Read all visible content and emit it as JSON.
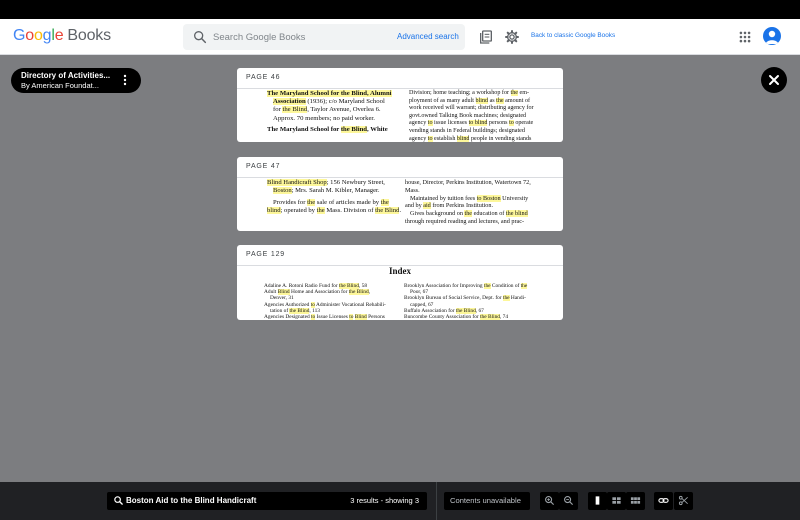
{
  "header": {
    "logo_google": "Google",
    "logo_books": "Books",
    "search_placeholder": "Search Google Books",
    "advanced_search": "Advanced search",
    "back_to_classic": "Back to classic Google Books"
  },
  "book": {
    "title": "Directory of Activities...",
    "author": "By American Foundat..."
  },
  "results": [
    {
      "page_label": "PAGE 46",
      "left": [
        "The Maryland School for the Blind, Alumni",
        "Association (1936); c/o Maryland School",
        "for the Blind, Taylor Avenue, Overlea 6.",
        "Approx. 70 members; no paid worker.",
        "The Maryland School for the Blind, White"
      ],
      "right": [
        "Division; home teaching; a workshop for the em-",
        "ployment of as many adult blind as the amount of",
        "work received will warrant; distributing agency for",
        "govt.owned Talking Book machines; designated",
        "agency to issue licenses to blind persons to operate",
        "vending stands in Federal buildings; designated",
        "agency to establish blind people in vending stands"
      ]
    },
    {
      "page_label": "PAGE 47",
      "left": [
        "Blind Handicraft Shop; 156 Newbury Street,",
        "Boston; Mrs. Sarah M. Kibler, Manager.",
        "Provides for the sale of articles made by the",
        "blind; operated by the Mass. Division of the Blind."
      ],
      "right": [
        "house, Director, Perkins Institution, Watertown 72,",
        "Mass.",
        "Maintained by tuition fees to Boston University",
        "and by aid from Perkins Institution.",
        "Gives background on the education of the blind",
        "through required reading and lectures, and prac-"
      ]
    },
    {
      "page_label": "PAGE 129",
      "index_title": "Index",
      "left": [
        "Adaline A. Rotoni Radio Fund for the Blind, 58",
        "Adult Blind Home and Association for the Blind,",
        "Denver, 31",
        "Agencies Authorized to Administer Vocational Rehabili-",
        "tation of the Blind, 113",
        "Agencies Designated to Issue Licenses to Blind Persons"
      ],
      "right": [
        "Brooklyn Association for Improving the Condition of the",
        "Poor, 67",
        "Brooklyn Bureau of Social Service, Dept. for the Handi-",
        "capped, 67",
        "Buffalo Association for the Blind, 67",
        "Buncombe County Association for the Blind, 74"
      ]
    }
  ],
  "bottom": {
    "query": "Boston Aid to the Blind Handicraft",
    "result_count": "3 results - showing 3",
    "contents": "Contents unavailable"
  },
  "colors": {
    "highlight": "#fdf79a",
    "link_blue": "#1a73e8",
    "viewer_bg": "#7c7d80",
    "toolbar_bg": "#202124"
  }
}
